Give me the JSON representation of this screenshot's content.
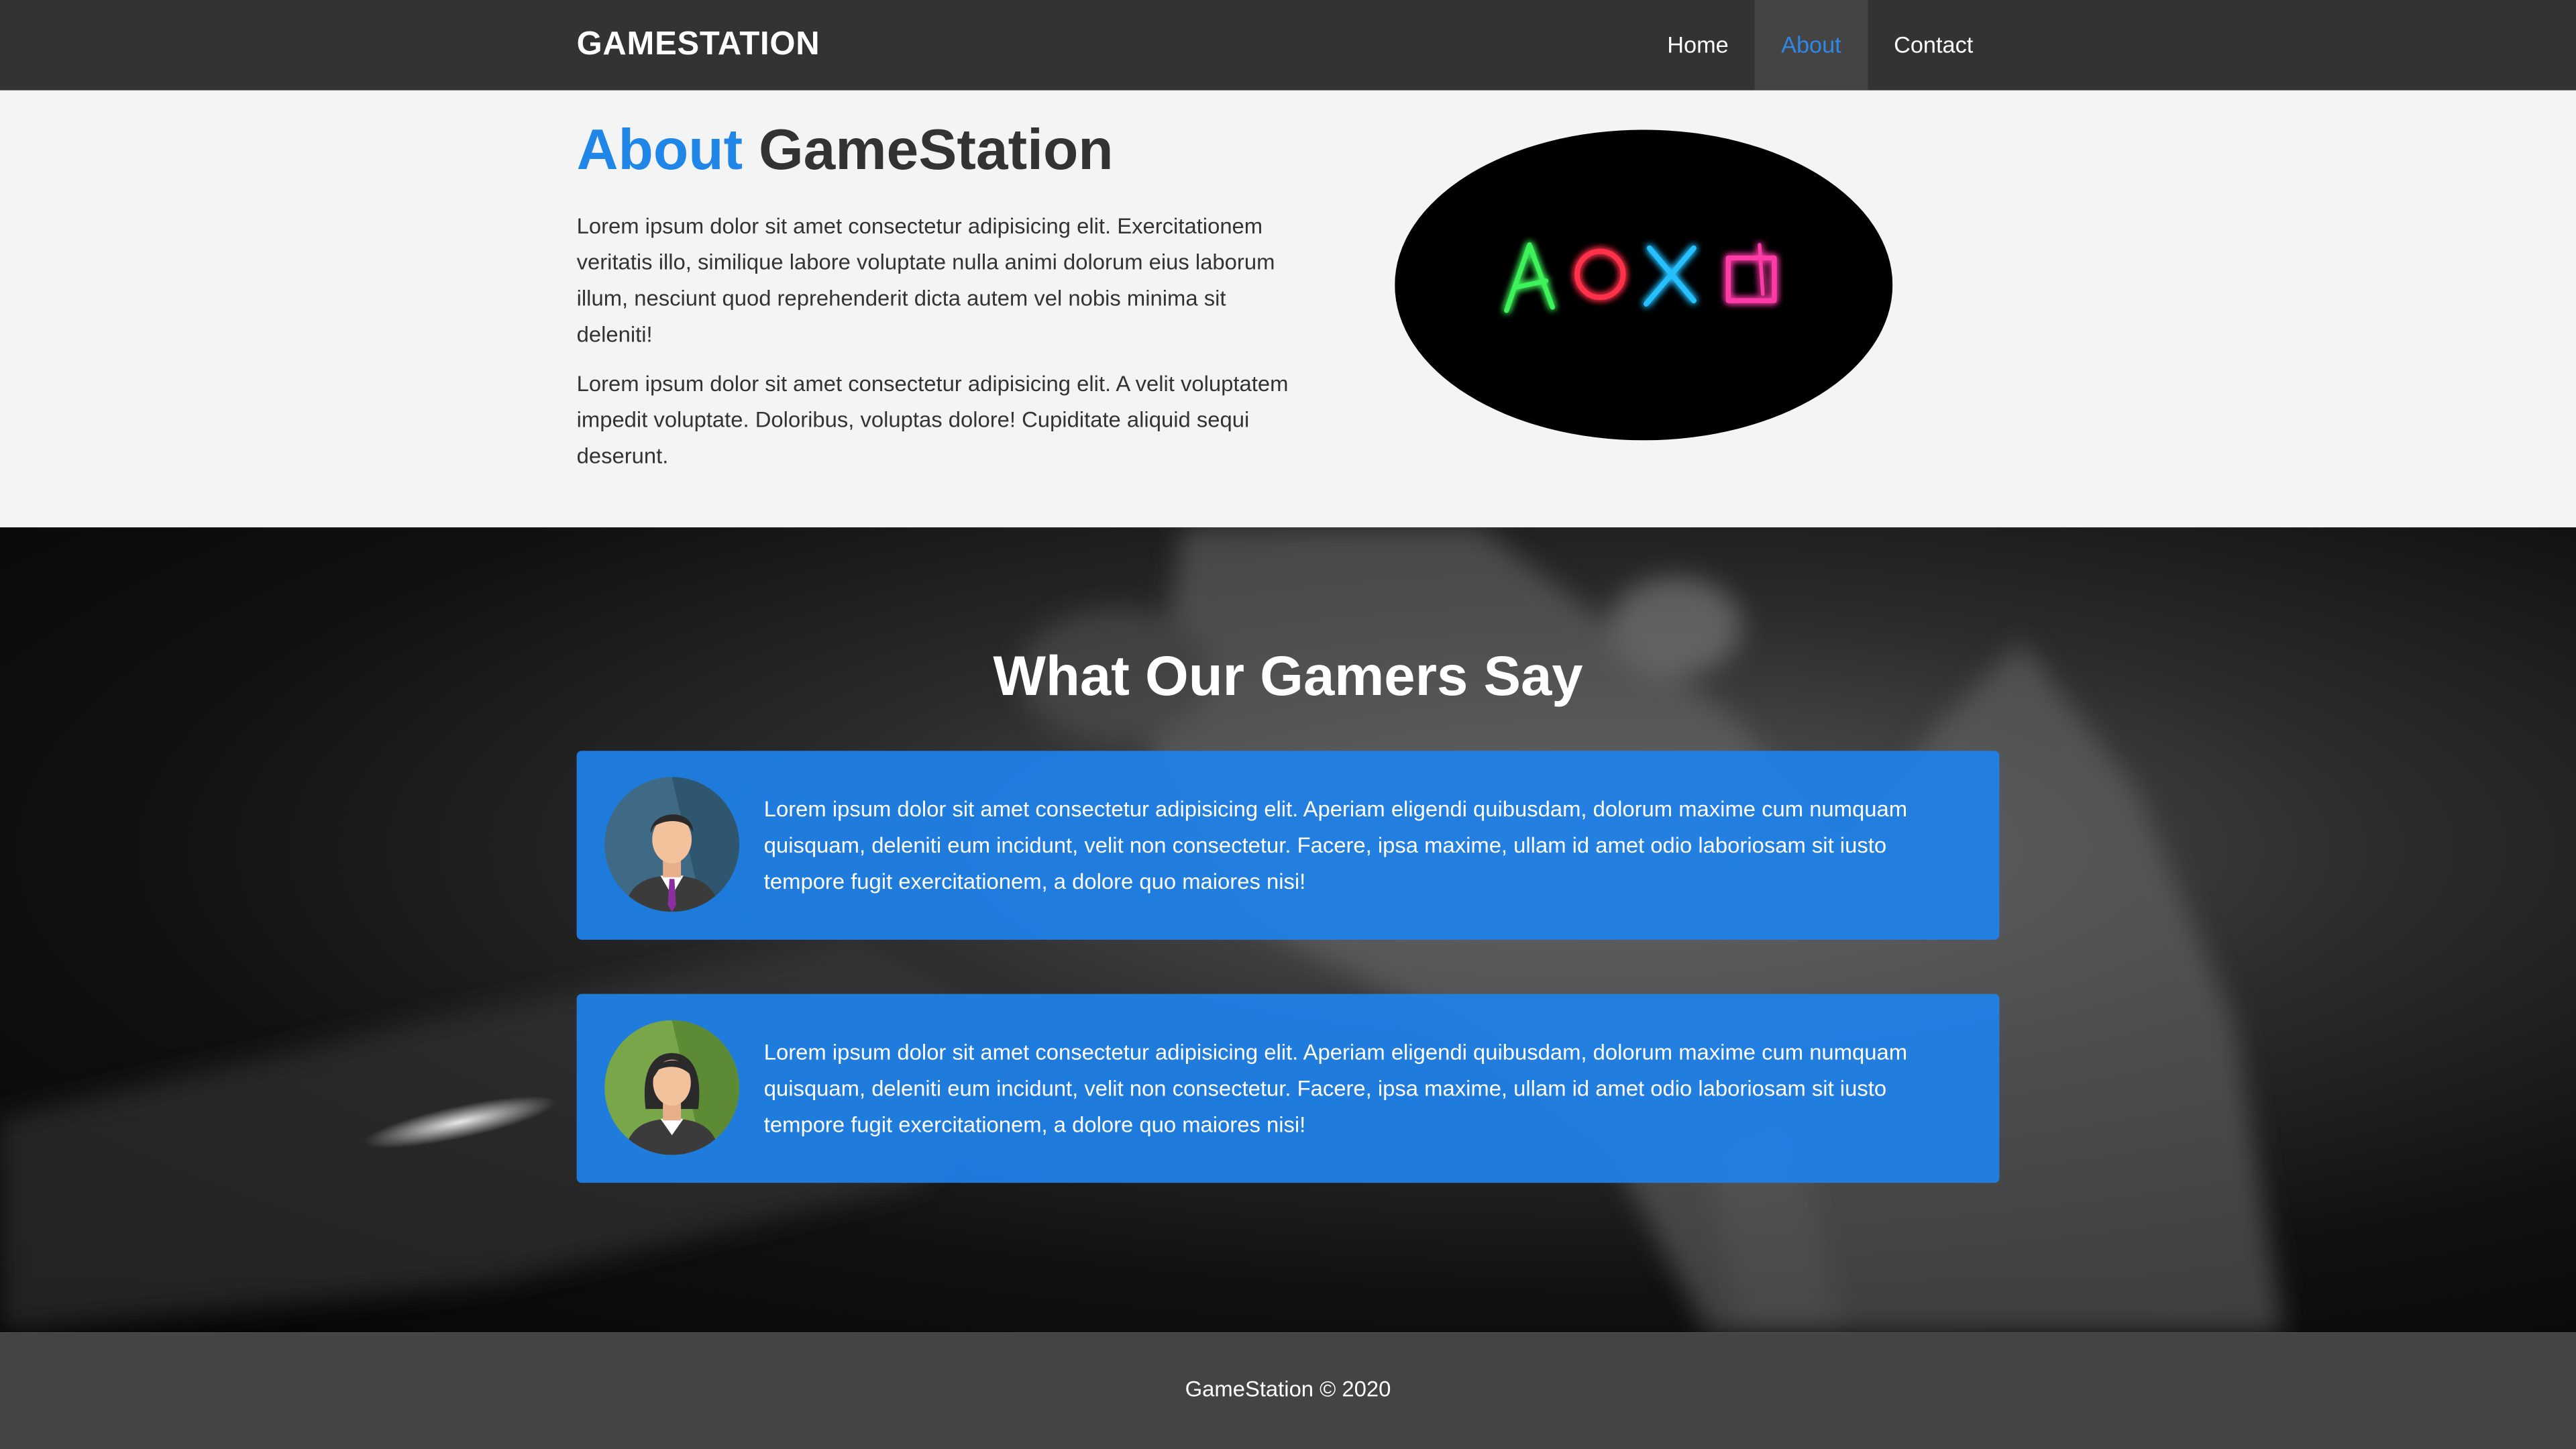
{
  "header": {
    "logo": "GAMESTATION",
    "nav": [
      {
        "label": "Home"
      },
      {
        "label": "About"
      },
      {
        "label": "Contact"
      }
    ]
  },
  "about": {
    "title_highlight": "About",
    "title_rest": "GameStation",
    "paragraphs": [
      "Lorem ipsum dolor sit amet consectetur adipisicing elit. Exercitationem veritatis illo, similique labore voluptate nulla animi dolorum eius laborum illum, nesciunt quod reprehenderit dicta autem vel nobis minima sit deleniti!",
      "Lorem ipsum dolor sit amet consectetur adipisicing elit. A velit voluptatem impedit voluptate. Doloribus, voluptas dolore! Cupiditate aliquid sequi deserunt."
    ],
    "image_icon": "playstation-neon-symbols"
  },
  "testimonials": {
    "title": "What Our Gamers Say",
    "items": [
      {
        "avatar": "male-avatar",
        "text": "Lorem ipsum dolor sit amet consectetur adipisicing elit. Aperiam eligendi quibusdam, dolorum maxime cum numquam quisquam, deleniti eum incidunt, velit non consectetur. Facere, ipsa maxime, ullam id amet odio laboriosam sit iusto tempore fugit exercitationem, a dolore quo maiores nisi!"
      },
      {
        "avatar": "female-avatar",
        "text": "Lorem ipsum dolor sit amet consectetur adipisicing elit. Aperiam eligendi quibusdam, dolorum maxime cum numquam quisquam, deleniti eum incidunt, velit non consectetur. Facere, ipsa maxime, ullam id amet odio laboriosam sit iusto tempore fugit exercitationem, a dolore quo maiores nisi!"
      }
    ]
  },
  "footer": {
    "text": "GameStation © 2020"
  },
  "colors": {
    "accent": "#2086e8",
    "header_bg": "#333333",
    "footer_bg": "#444444",
    "card_bg": "#1e82eb"
  }
}
